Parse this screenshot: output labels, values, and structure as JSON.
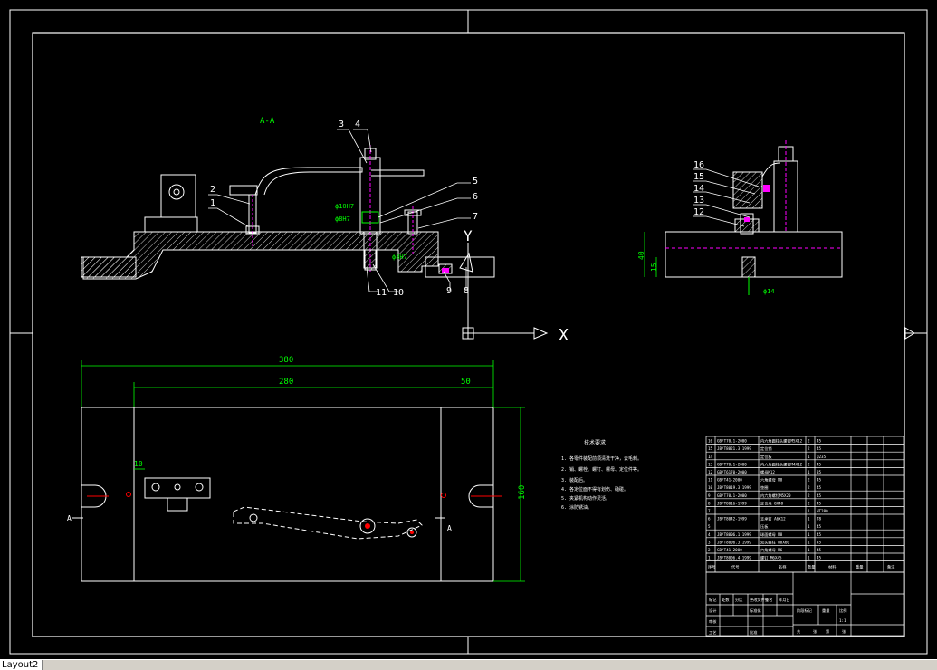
{
  "colors": {
    "background": "#000000",
    "line": "#ffffff",
    "dimension": "#00ff00",
    "hatch": "#ffffff",
    "highlight": "#ff00ff",
    "red": "#ff0000"
  },
  "drawing": {
    "section_label": "A-A",
    "part_numbers_left": [
      "3",
      "4",
      "2",
      "1",
      "5",
      "6",
      "7",
      "9",
      "8",
      "11",
      "10"
    ],
    "part_numbers_right": [
      "16",
      "15",
      "14",
      "13",
      "12"
    ],
    "ucs": {
      "y_label": "Y",
      "x_label": "X"
    },
    "dimensions_plan": {
      "overall_length": "380",
      "hole_spacing": "280",
      "end_offset": "50",
      "width": "160",
      "small_offset": "10"
    },
    "dimensions_side": {
      "height": "40",
      "base": "15",
      "hole": "ϕ14"
    },
    "section_marks": [
      "A",
      "A"
    ],
    "tech_title": "技术要求",
    "tech_notes": [
      "1. 各零件装配前须清洗干净，去毛刺。",
      "2. 销、螺栓、螺钉、螺母、定位件等。",
      "3. 装配后。",
      "4. 各定位面不得有划伤、磕碰。",
      "5. 夹紧机构动作灵活。",
      "6. 涂防锈油。"
    ]
  },
  "bom": {
    "rows": [
      {
        "no": "16",
        "code": "GB/T70.1-2000",
        "name": "内六角圆柱头螺钉M5X12",
        "qty": "2",
        "mat": "45"
      },
      {
        "no": "15",
        "code": "JB/T8021.3-1999",
        "name": "定位销",
        "qty": "2",
        "mat": "45"
      },
      {
        "no": "14",
        "code": "",
        "name": "定位板",
        "qty": "1",
        "mat": "Q235"
      },
      {
        "no": "13",
        "code": "GB/T70.1-2000",
        "name": "内六角圆柱头螺钉M4X12",
        "qty": "2",
        "mat": "45"
      },
      {
        "no": "12",
        "code": "GB/T6170-2000",
        "name": "螺母M12",
        "qty": "1",
        "mat": "35"
      },
      {
        "no": "11",
        "code": "GB/T41-2000",
        "name": "六角螺母 M8",
        "qty": "2",
        "mat": "45"
      },
      {
        "no": "10",
        "code": "JB/T8019.3-1999",
        "name": "垫圈",
        "qty": "2",
        "mat": "45"
      },
      {
        "no": "9",
        "code": "GB/T70.1-2000",
        "name": "内六角螺钉M5X20",
        "qty": "2",
        "mat": "45"
      },
      {
        "no": "8",
        "code": "JB/T8016-1999",
        "name": "定位块 8X48",
        "qty": "2",
        "mat": "45"
      },
      {
        "no": "7",
        "code": "",
        "name": "",
        "qty": "1",
        "mat": "HT200"
      },
      {
        "no": "6",
        "code": "JB/T8042-1999",
        "name": "支承钉 A6X12",
        "qty": "1",
        "mat": "T8"
      },
      {
        "no": "5",
        "code": "",
        "name": "压板",
        "qty": "1",
        "mat": "45"
      },
      {
        "no": "4",
        "code": "JB/T8006.1-1999",
        "name": "球面螺母 M8",
        "qty": "1",
        "mat": "45"
      },
      {
        "no": "3",
        "code": "JB/T8006.3-1999",
        "name": "双头螺柱 M8X60",
        "qty": "1",
        "mat": "45"
      },
      {
        "no": "2",
        "code": "GB/T41-2000",
        "name": "六角螺母 M6",
        "qty": "1",
        "mat": "45"
      },
      {
        "no": "1",
        "code": "JB/T8006.4-1999",
        "name": "螺钉 M6X45",
        "qty": "1",
        "mat": "45"
      }
    ],
    "header": {
      "no": "序号",
      "code": "代号",
      "name": "名称",
      "qty": "数量",
      "mat": "材料",
      "weight": "重量",
      "remark": "备注"
    }
  },
  "title_block": {
    "row1": [
      "标记",
      "处数",
      "分区",
      "更改文件号",
      "签名",
      "年月日"
    ],
    "row2": [
      "设计",
      "标准化"
    ],
    "row3": [
      "审核"
    ],
    "row4": [
      "工艺",
      "批准"
    ],
    "stage": [
      "阶段标记",
      "重量",
      "比例"
    ],
    "scale": "1:1",
    "sheets": [
      "共",
      "张",
      "第",
      "张"
    ]
  },
  "tabs": {
    "active": "Layout2"
  }
}
